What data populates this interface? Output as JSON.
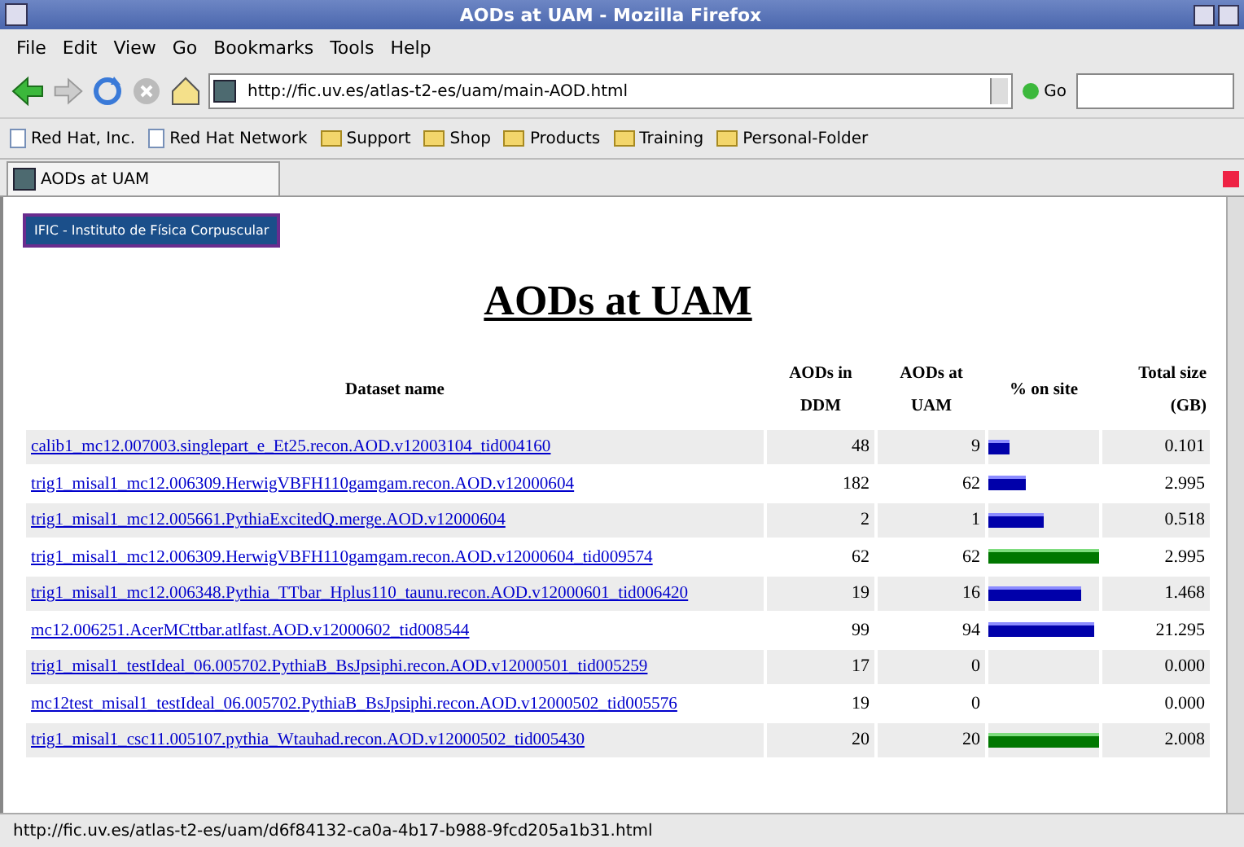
{
  "window": {
    "title": "AODs at UAM - Mozilla Firefox"
  },
  "menu": [
    "File",
    "Edit",
    "View",
    "Go",
    "Bookmarks",
    "Tools",
    "Help"
  ],
  "address": {
    "value": "http://fic.uv.es/atlas-t2-es/uam/main-AOD.html"
  },
  "go_label": "Go",
  "bookmarks": [
    {
      "label": "Red Hat, Inc.",
      "kind": "page"
    },
    {
      "label": "Red Hat Network",
      "kind": "page"
    },
    {
      "label": "Support",
      "kind": "folder"
    },
    {
      "label": "Shop",
      "kind": "folder"
    },
    {
      "label": "Products",
      "kind": "folder"
    },
    {
      "label": "Training",
      "kind": "folder"
    },
    {
      "label": "Personal-Folder",
      "kind": "folder"
    }
  ],
  "tabs": [
    {
      "label": "AODs at UAM",
      "selected": true
    }
  ],
  "page": {
    "banner": "IFIC - Instituto de Física Corpuscular",
    "heading": "AODs at UAM",
    "table": {
      "columns": [
        "Dataset name",
        "AODs in DDM",
        "AODs at UAM",
        "% on site",
        "Total size (GB)"
      ],
      "rows": [
        {
          "name": "calib1_mc12.007003.singlepart_e_Et25.recon.AOD.v12003104_tid004160",
          "ddm": "48",
          "uam": "9",
          "level": 0.19,
          "size": "0.101"
        },
        {
          "name": "trig1_misal1_mc12.006309.HerwigVBFH110gamgam.recon.AOD.v12000604",
          "ddm": "182",
          "uam": "62",
          "level": 0.34,
          "size": "2.995"
        },
        {
          "name": "trig1_misal1_mc12.005661.PythiaExcitedQ.merge.AOD.v12000604",
          "ddm": "2",
          "uam": "1",
          "level": 0.5,
          "size": "0.518"
        },
        {
          "name": "trig1_misal1_mc12.006309.HerwigVBFH110gamgam.recon.AOD.v12000604_tid009574",
          "ddm": "62",
          "uam": "62",
          "level": 1,
          "size": "2.995"
        },
        {
          "name": "trig1_misal1_mc12.006348.Pythia_TTbar_Hplus110_taunu.recon.AOD.v12000601_tid006420",
          "ddm": "19",
          "uam": "16",
          "level": 0.84,
          "size": "1.468"
        },
        {
          "name": "mc12.006251.AcerMCttbar.atlfast.AOD.v12000602_tid008544",
          "ddm": "99",
          "uam": "94",
          "level": 0.95,
          "size": "21.295"
        },
        {
          "name": "trig1_misal1_testIdeal_06.005702.PythiaB_BsJpsiphi.recon.AOD.v12000501_tid005259",
          "ddm": "17",
          "uam": "0",
          "size": "0.000"
        },
        {
          "name": "mc12test_misal1_testIdeal_06.005702.PythiaB_BsJpsiphi.recon.AOD.v12000502_tid005576",
          "ddm": "19",
          "uam": "0",
          "size": "0.000"
        },
        {
          "name": "trig1_misal1_csc11.005107.pythia_Wtauhad.recon.AOD.v12000502_tid005430",
          "ddm": "20",
          "uam": "20",
          "level": 1,
          "size": "2.008"
        }
      ]
    }
  },
  "status_bar": "http://fic.uv.es/atlas-t2-es/uam/d6f84132-ca0a-4b17-b988-9fcd205a1b31.html"
}
